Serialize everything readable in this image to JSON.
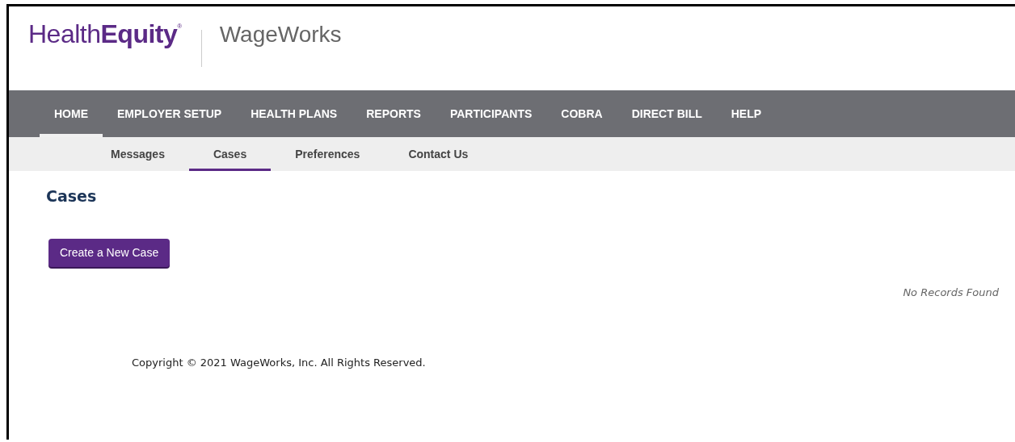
{
  "logo": {
    "brand": "Health**Equity**$^{®}$",
    "product": "WageWorks"
  },
  "main_nav": [
    {
      "label": "HOME",
      "selected": true
    },
    {
      "label": "EMPLOYER SETUP",
      "selected": false
    },
    {
      "label": "HEALTH PLANS",
      "selected": false
    },
    {
      "label": "REPORTS",
      "selected": false
    },
    {
      "label": "PARTICIPANTS",
      "selected": false
    },
    {
      "label": "COBRA",
      "selected": false
    },
    {
      "label": "DIRECT BILL",
      "selected": false
    },
    {
      "label": "HELP",
      "selected": false
    }
  ],
  "sub_nav": [
    {
      "label": "Messages",
      "selected": false
    },
    {
      "label": "Cases",
      "selected": true
    },
    {
      "label": "Preferences",
      "selected": false
    },
    {
      "label": "Contact Us",
      "selected": false
    }
  ],
  "page_title": "Cases",
  "create_button": "Create a New Case",
  "empty_message": "No Records Found",
  "footer": "Copyright © 2021 WageWorks, Inc. All Rights Reserved."
}
